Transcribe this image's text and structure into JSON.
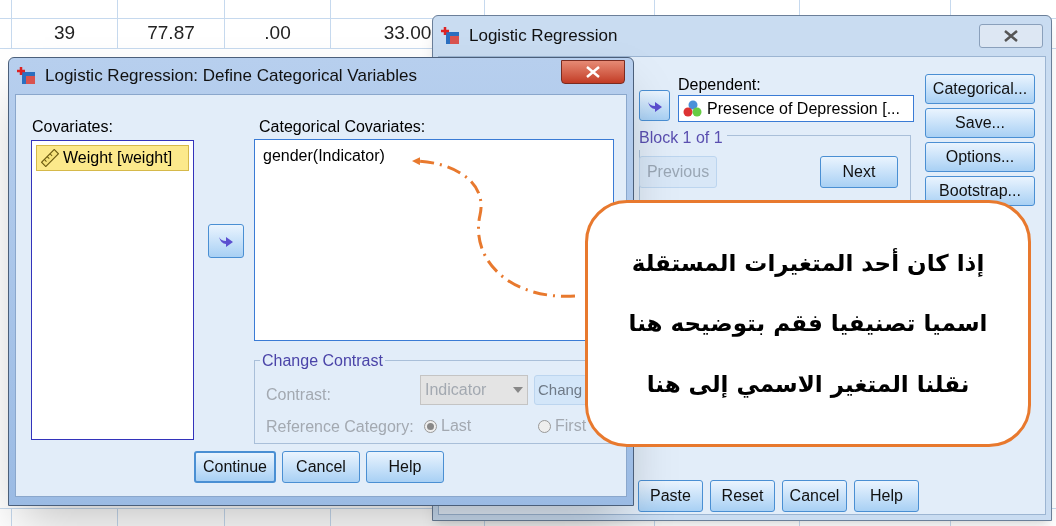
{
  "spreadsheet": {
    "rows": [
      {
        "cells": [
          "39",
          "77.87",
          ".00",
          "33.00"
        ]
      }
    ]
  },
  "main_dialog": {
    "title": "Logistic Regression",
    "dependent_label": "Dependent:",
    "dependent_value": "Presence of Depression [...",
    "block_label": "Block 1 of 1",
    "block_buttons": [
      {
        "label": "Previous",
        "disabled": true
      },
      {
        "label": "Next",
        "disabled": false
      }
    ],
    "side_buttons": [
      "Categorical...",
      "Save...",
      "Options...",
      "Bootstrap..."
    ],
    "footer_buttons": [
      "Paste",
      "Reset",
      "Cancel",
      "Help"
    ]
  },
  "category_dialog": {
    "title": "Logistic Regression: Define Categorical Variables",
    "covariates_label": "Covariates:",
    "covariates": [
      {
        "label": "Weight [weight]",
        "selected": true
      }
    ],
    "categorical_label": "Categorical Covariates:",
    "categorical": [
      {
        "label": "gender(Indicator)",
        "selected": false
      }
    ],
    "contrast_group": {
      "title": "Change Contrast",
      "disabled": true,
      "contrast_label": "Contrast:",
      "contrast_value": "Indicator",
      "change_button": "Chang",
      "reference_label": "Reference Category:",
      "options": [
        {
          "label": "Last",
          "selected": true
        },
        {
          "label": "First",
          "selected": false
        }
      ]
    },
    "buttons": [
      "Continue",
      "Cancel",
      "Help"
    ]
  },
  "callout": {
    "lines": [
      "إذا كان أحد المتغيرات المستقلة",
      "اسميا تصنيفيا فقم بتوضيحه هنا",
      "نقلنا المتغير الاسمي إلى هنا"
    ]
  }
}
